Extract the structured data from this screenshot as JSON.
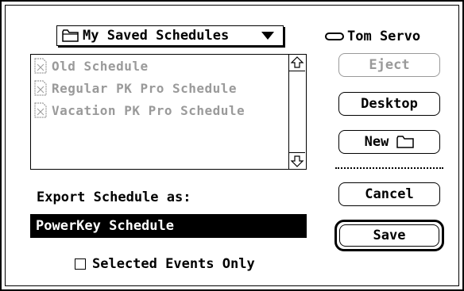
{
  "location_popup": {
    "label": "My Saved Schedules",
    "icon": "folder-icon"
  },
  "volume": {
    "name": "Tom Servo",
    "icon": "disk-icon"
  },
  "file_list": {
    "items": [
      {
        "name": "Old Schedule",
        "icon": "document-icon",
        "enabled": false
      },
      {
        "name": "Regular PK Pro Schedule",
        "icon": "document-icon",
        "enabled": false
      },
      {
        "name": "Vacation PK Pro Schedule",
        "icon": "document-icon",
        "enabled": false
      }
    ]
  },
  "buttons": {
    "eject": "Eject",
    "desktop": "Desktop",
    "new": "New",
    "cancel": "Cancel",
    "save": "Save"
  },
  "export": {
    "label": "Export Schedule as:",
    "value": "PowerKey Schedule"
  },
  "options": {
    "selected_events_only": {
      "label": "Selected Events Only",
      "checked": false
    }
  },
  "colors": {
    "disabled": "#9a9a9a",
    "ink": "#000000",
    "background": "#ffffff"
  }
}
